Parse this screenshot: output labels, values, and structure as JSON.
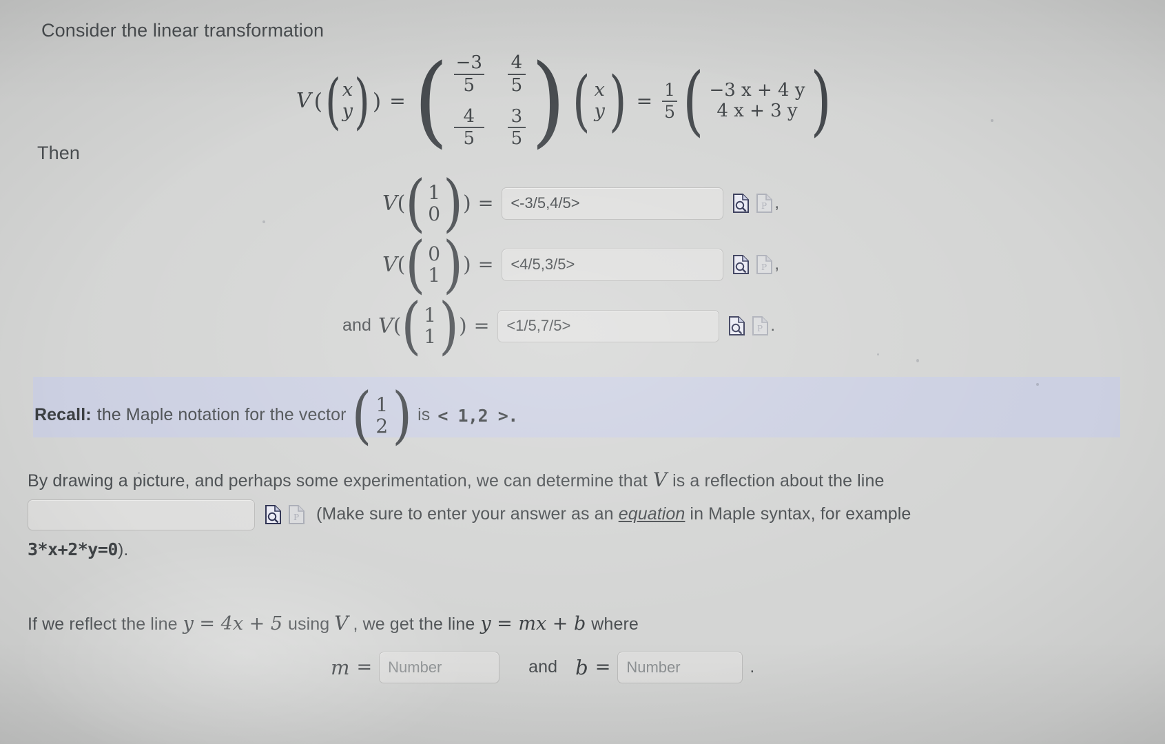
{
  "intro": {
    "line1": "Consider the linear transformation",
    "then_label": "Then",
    "and_label": "and"
  },
  "definition": {
    "lhs_fn": "V",
    "lhs_vec": [
      "x",
      "y"
    ],
    "equals": "=",
    "matrix": [
      [
        {
          "num": "−3",
          "den": "5"
        },
        {
          "num": "4",
          "den": "5"
        }
      ],
      [
        {
          "num": "4",
          "den": "5"
        },
        {
          "num": "3",
          "den": "5"
        }
      ]
    ],
    "times_vec": [
      "x",
      "y"
    ],
    "equals2": "=",
    "scalar": {
      "num": "1",
      "den": "5"
    },
    "result_vec": [
      "−3 x + 4 y",
      "4 x + 3 y"
    ]
  },
  "questions": [
    {
      "fn": "V",
      "vec": [
        "1",
        "0"
      ],
      "equals": "=",
      "value": "<-3/5,4/5>",
      "placeholder": "",
      "trailing": ",",
      "preview_icon": "document-magnifier-icon",
      "palette_icon": "document-maple-icon"
    },
    {
      "fn": "V",
      "vec": [
        "0",
        "1"
      ],
      "equals": "=",
      "value": "<4/5,3/5>",
      "placeholder": "",
      "trailing": ",",
      "preview_icon": "document-magnifier-icon",
      "palette_icon": "document-maple-icon"
    },
    {
      "prefix": "and",
      "fn": "V",
      "vec": [
        "1",
        "1"
      ],
      "equals": "=",
      "value": "<1/5,7/5>",
      "placeholder": "",
      "trailing": ".",
      "preview_icon": "document-magnifier-icon",
      "palette_icon": "document-maple-icon"
    }
  ],
  "recall": {
    "bold_label": "Recall:",
    "text_before": "the Maple notation for the vector",
    "vector": [
      "1",
      "2"
    ],
    "text_after": "is",
    "maple": "< 1,2 >.",
    "band_color": "#ccd0e2"
  },
  "reflection": {
    "sentence_part1": "By drawing a picture, and perhaps some experimentation, we can determine that",
    "var_V": "V",
    "sentence_part2": "is a reflection about the line",
    "input_value": "",
    "input_placeholder": "",
    "note_open": "(Make sure to enter your answer as an",
    "note_italic": "equation",
    "note_rest": "in Maple syntax, for example",
    "example": "3*x+2*y=0",
    "note_close": ").",
    "preview_icon": "document-magnifier-icon",
    "palette_icon": "document-maple-icon"
  },
  "final": {
    "text_part1": "If we reflect the line",
    "eq_given": "y = 4x + 5",
    "text_part2": "using",
    "var_V": "V",
    "text_part3": ", we get the line",
    "eq_target": "y = mx + b",
    "text_part4": "where",
    "m_label": "m",
    "m_equals": "=",
    "m_value": "",
    "m_placeholder": "Number",
    "and_label": "and",
    "b_label": "b",
    "b_equals": "=",
    "b_value": "",
    "b_placeholder": "Number",
    "period": "."
  }
}
